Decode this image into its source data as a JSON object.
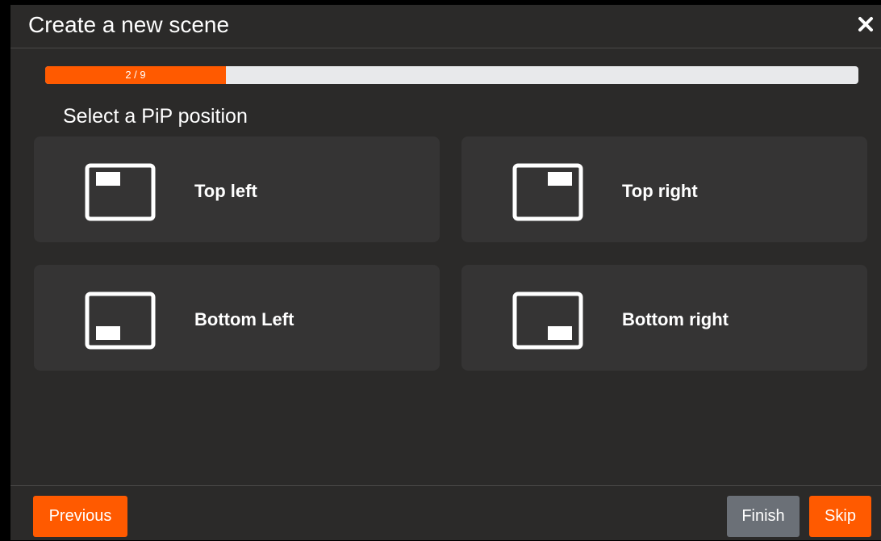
{
  "dialog": {
    "title": "Create a new scene",
    "close_icon": "close-icon"
  },
  "progress": {
    "label": "2 / 9",
    "current": 2,
    "total": 9,
    "fill_color": "#ff5a00",
    "track_color": "#e8e9eb"
  },
  "step": {
    "heading": "Select a PiP position",
    "options": [
      {
        "label": "Top left",
        "icon": "pip-top-left-icon"
      },
      {
        "label": "Top right",
        "icon": "pip-top-right-icon"
      },
      {
        "label": "Bottom Left",
        "icon": "pip-bottom-left-icon"
      },
      {
        "label": "Bottom right",
        "icon": "pip-bottom-right-icon"
      }
    ]
  },
  "footer": {
    "previous_label": "Previous",
    "finish_label": "Finish",
    "skip_label": "Skip"
  },
  "colors": {
    "accent": "#ff5a00",
    "background": "#2b2a29",
    "card": "#353434",
    "finish_button": "#6b7077"
  }
}
